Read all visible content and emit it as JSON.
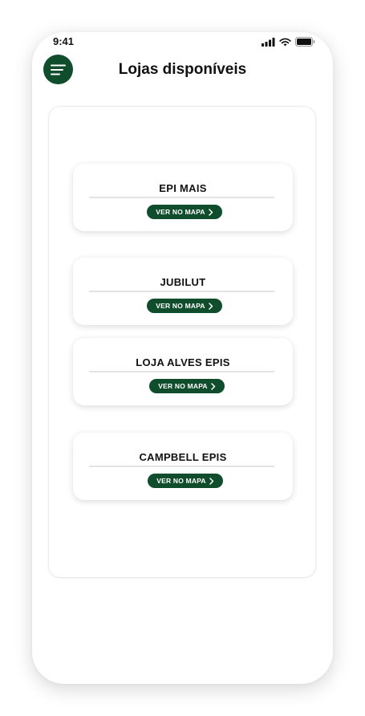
{
  "status_bar": {
    "time": "9:41"
  },
  "header": {
    "title": "Lojas disponíveis",
    "menu_icon": "hamburger-menu-icon"
  },
  "stores": [
    {
      "name": "EPI MAIS",
      "map_button": "VER NO MAPA"
    },
    {
      "name": "JUBILUT",
      "map_button": "VER NO MAPA"
    },
    {
      "name": "LOJA ALVES EPIS",
      "map_button": "VER NO MAPA"
    },
    {
      "name": "CAMPBELL EPIS",
      "map_button": "VER NO MAPA"
    }
  ],
  "colors": {
    "brand_green": "#0f4d2c"
  }
}
